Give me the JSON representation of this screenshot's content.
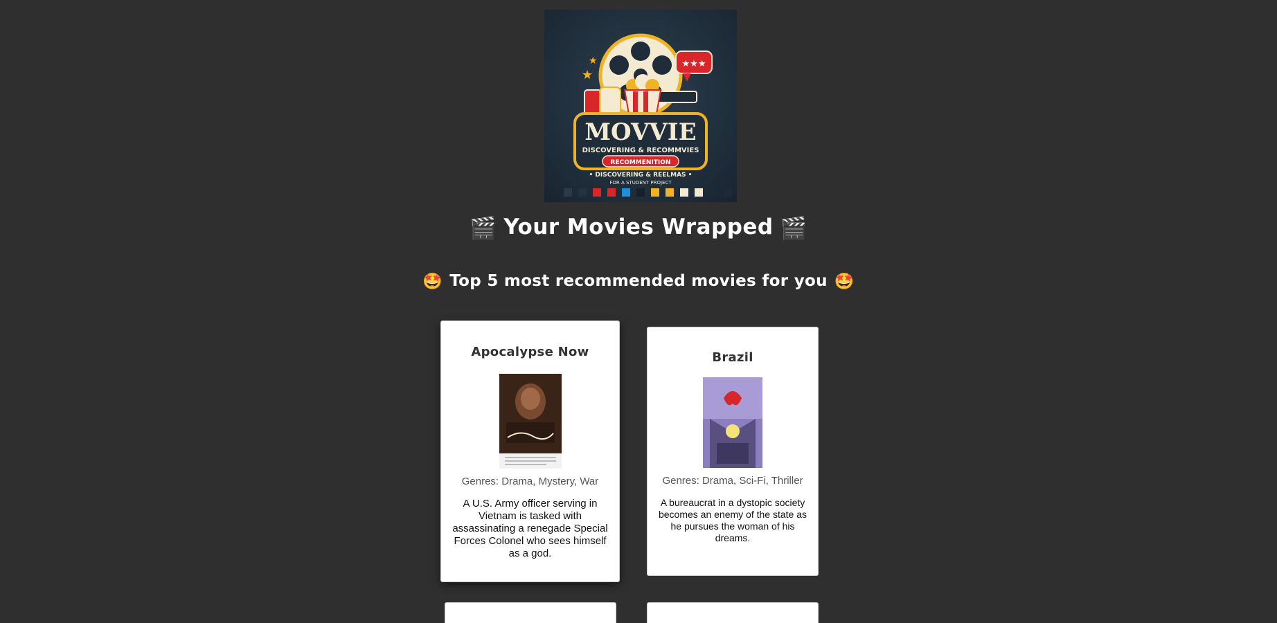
{
  "logo": {
    "brand": "MOVVIE",
    "tagline": "DISCOVERING & RECOMMVIES",
    "ribbon": "RECOMMENITION",
    "subline": "• DISCOVERING & REELMAS •",
    "footnote": "FOR A STUDENT PROJECT"
  },
  "header": {
    "title": "Your Movies Wrapped",
    "title_emoji": "🎬",
    "subtitle": "Top 5 most recommended movies for you",
    "subtitle_emoji": "🤩"
  },
  "movies": [
    {
      "title": "Apocalypse Now",
      "genres": "Genres: Drama, Mystery, War",
      "description": "A U.S. Army officer serving in Vietnam is tasked with assassinating a renegade Special Forces Colonel who sees himself as a god."
    },
    {
      "title": "Brazil",
      "genres": "Genres: Drama, Sci-Fi, Thriller",
      "description": "A bureaucrat in a dystopic society becomes an enemy of the state as he pursues the woman of his dreams."
    }
  ],
  "colors": {
    "background": "#2f2f2f",
    "card": "#ffffff",
    "logo_red": "#d9262a",
    "logo_gold": "#f0b323",
    "logo_cream": "#f4ead2"
  }
}
